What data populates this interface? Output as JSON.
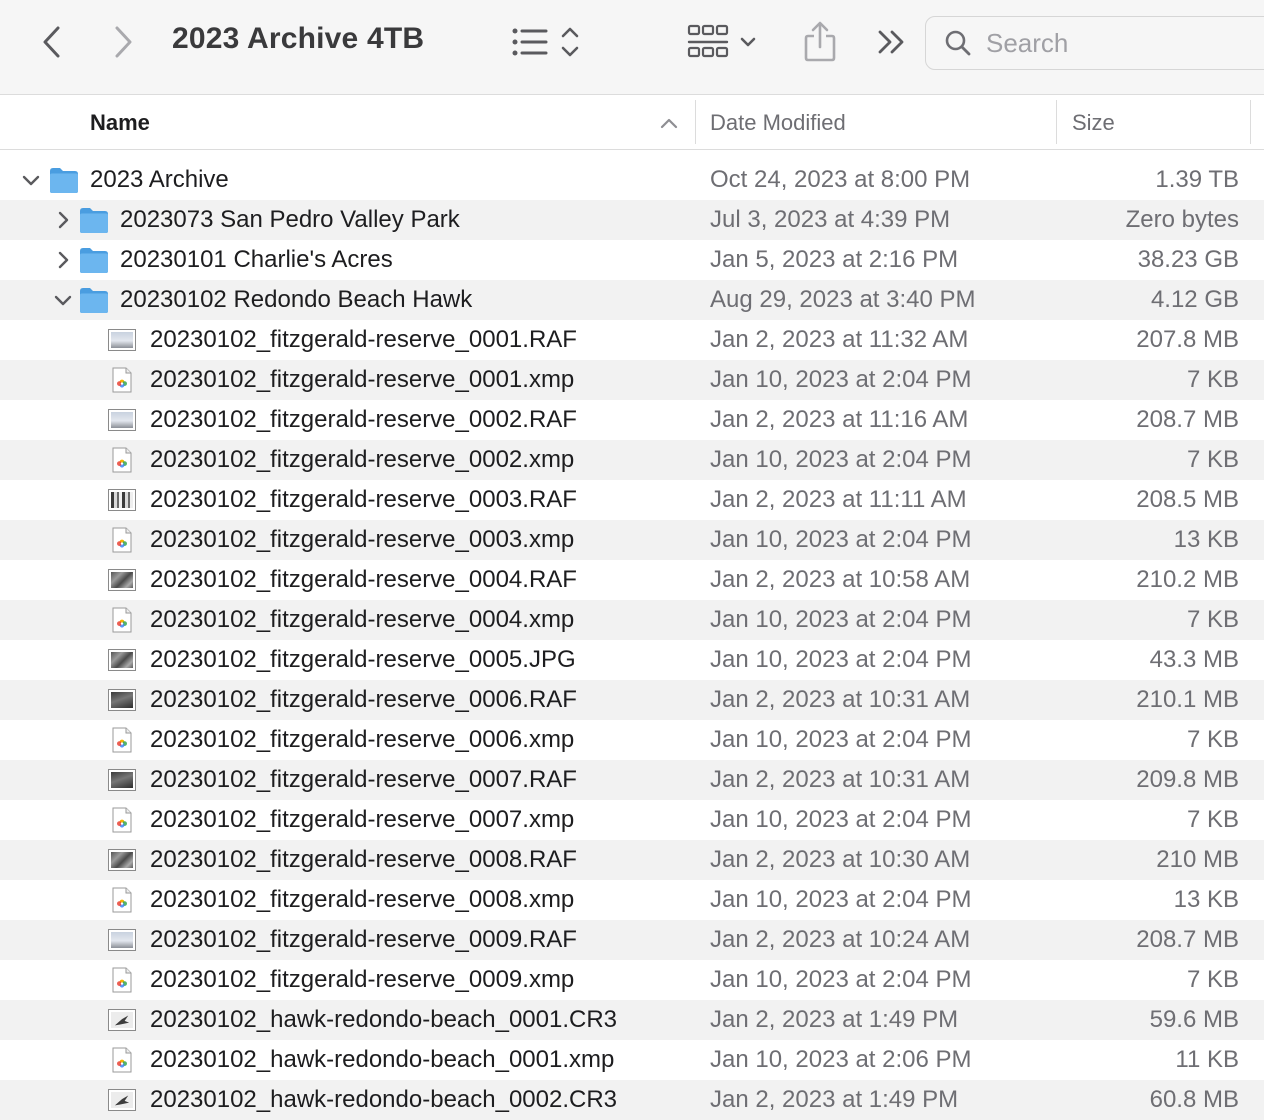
{
  "window": {
    "title": "2023 Archive 4TB"
  },
  "toolbar": {
    "back_icon": "chevron-left-icon",
    "forward_icon": "chevron-right-icon",
    "list_view_icon": "list-view-icon",
    "grid_view_icon": "grid-view-icon",
    "share_icon": "share-icon",
    "more_icon": "double-chevron-icon"
  },
  "search": {
    "placeholder": "Search",
    "icon": "search-icon"
  },
  "columns": {
    "name": "Name",
    "date": "Date Modified",
    "size": "Size",
    "sort": "ascending"
  },
  "colors": {
    "folder": "#6cb6ef",
    "folder_dark": "#4a9de0",
    "row_alt": "#f2f2f2",
    "secondary_text": "#6e6e73"
  },
  "rows": [
    {
      "kind": "folder",
      "expanded": true,
      "level": 0,
      "name": "2023 Archive",
      "date": "Oct 24, 2023 at 8:00 PM",
      "size": "1.39 TB"
    },
    {
      "kind": "folder",
      "expanded": false,
      "level": 1,
      "name": "2023073 San Pedro Valley Park",
      "date": "Jul 3, 2023 at 4:39 PM",
      "size": "Zero bytes"
    },
    {
      "kind": "folder",
      "expanded": false,
      "level": 1,
      "name": "20230101 Charlie's Acres",
      "date": "Jan 5, 2023 at 2:16 PM",
      "size": "38.23 GB"
    },
    {
      "kind": "folder",
      "expanded": true,
      "level": 1,
      "name": "20230102 Redondo Beach Hawk",
      "date": "Aug 29, 2023 at 3:40 PM",
      "size": "4.12 GB"
    },
    {
      "kind": "image",
      "thumb": "sky",
      "level": 2,
      "name": "20230102_fitzgerald-reserve_0001.RAF",
      "date": "Jan 2, 2023 at 11:32 AM",
      "size": "207.8 MB"
    },
    {
      "kind": "xmp",
      "level": 2,
      "name": "20230102_fitzgerald-reserve_0001.xmp",
      "date": "Jan 10, 2023 at 2:04 PM",
      "size": "7 KB"
    },
    {
      "kind": "image",
      "thumb": "sky",
      "level": 2,
      "name": "20230102_fitzgerald-reserve_0002.RAF",
      "date": "Jan 2, 2023 at 11:16 AM",
      "size": "208.7 MB"
    },
    {
      "kind": "xmp",
      "level": 2,
      "name": "20230102_fitzgerald-reserve_0002.xmp",
      "date": "Jan 10, 2023 at 2:04 PM",
      "size": "7 KB"
    },
    {
      "kind": "image",
      "thumb": "trees",
      "level": 2,
      "name": "20230102_fitzgerald-reserve_0003.RAF",
      "date": "Jan 2, 2023 at 11:11 AM",
      "size": "208.5 MB"
    },
    {
      "kind": "xmp",
      "level": 2,
      "name": "20230102_fitzgerald-reserve_0003.xmp",
      "date": "Jan 10, 2023 at 2:04 PM",
      "size": "13 KB"
    },
    {
      "kind": "image",
      "thumb": "rock",
      "level": 2,
      "name": "20230102_fitzgerald-reserve_0004.RAF",
      "date": "Jan 2, 2023 at 10:58 AM",
      "size": "210.2 MB"
    },
    {
      "kind": "xmp",
      "level": 2,
      "name": "20230102_fitzgerald-reserve_0004.xmp",
      "date": "Jan 10, 2023 at 2:04 PM",
      "size": "7 KB"
    },
    {
      "kind": "image",
      "thumb": "rock",
      "level": 2,
      "name": "20230102_fitzgerald-reserve_0005.JPG",
      "date": "Jan 10, 2023 at 2:04 PM",
      "size": "43.3 MB"
    },
    {
      "kind": "image",
      "thumb": "dark",
      "level": 2,
      "name": "20230102_fitzgerald-reserve_0006.RAF",
      "date": "Jan 2, 2023 at 10:31 AM",
      "size": "210.1 MB"
    },
    {
      "kind": "xmp",
      "level": 2,
      "name": "20230102_fitzgerald-reserve_0006.xmp",
      "date": "Jan 10, 2023 at 2:04 PM",
      "size": "7 KB"
    },
    {
      "kind": "image",
      "thumb": "dark",
      "level": 2,
      "name": "20230102_fitzgerald-reserve_0007.RAF",
      "date": "Jan 2, 2023 at 10:31 AM",
      "size": "209.8 MB"
    },
    {
      "kind": "xmp",
      "level": 2,
      "name": "20230102_fitzgerald-reserve_0007.xmp",
      "date": "Jan 10, 2023 at 2:04 PM",
      "size": "7 KB"
    },
    {
      "kind": "image",
      "thumb": "rock",
      "level": 2,
      "name": "20230102_fitzgerald-reserve_0008.RAF",
      "date": "Jan 2, 2023 at 10:30 AM",
      "size": "210 MB"
    },
    {
      "kind": "xmp",
      "level": 2,
      "name": "20230102_fitzgerald-reserve_0008.xmp",
      "date": "Jan 10, 2023 at 2:04 PM",
      "size": "13 KB"
    },
    {
      "kind": "image",
      "thumb": "sky",
      "level": 2,
      "name": "20230102_fitzgerald-reserve_0009.RAF",
      "date": "Jan 2, 2023 at 10:24 AM",
      "size": "208.7 MB"
    },
    {
      "kind": "xmp",
      "level": 2,
      "name": "20230102_fitzgerald-reserve_0009.xmp",
      "date": "Jan 10, 2023 at 2:04 PM",
      "size": "7 KB"
    },
    {
      "kind": "image",
      "thumb": "bird",
      "level": 2,
      "name": "20230102_hawk-redondo-beach_0001.CR3",
      "date": "Jan 2, 2023 at 1:49 PM",
      "size": "59.6 MB"
    },
    {
      "kind": "xmp",
      "level": 2,
      "name": "20230102_hawk-redondo-beach_0001.xmp",
      "date": "Jan 10, 2023 at 2:06 PM",
      "size": "11 KB"
    },
    {
      "kind": "image",
      "thumb": "bird",
      "level": 2,
      "name": "20230102_hawk-redondo-beach_0002.CR3",
      "date": "Jan 2, 2023 at 1:49 PM",
      "size": "60.8 MB"
    }
  ]
}
